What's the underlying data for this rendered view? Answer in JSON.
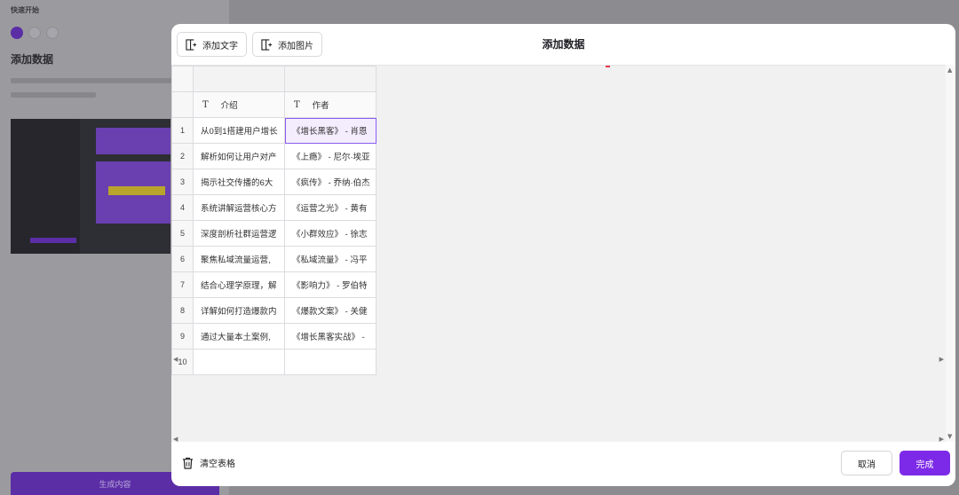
{
  "background": {
    "step_tag": "快速开始",
    "heading": "添加数据",
    "action_label": "生成内容"
  },
  "modal": {
    "title": "添加数据",
    "add_text_label": "添加文字",
    "add_image_label": "添加图片",
    "clear_label": "清空表格",
    "cancel_label": "取消",
    "done_label": "完成"
  },
  "table": {
    "columns": [
      {
        "type_icon": "T",
        "label": "介绍"
      },
      {
        "type_icon": "T",
        "label": "作者"
      }
    ],
    "rows": [
      {
        "num": "1",
        "c1": "从0到1搭建用户增长",
        "c2": "《增长黑客》 - 肖恩"
      },
      {
        "num": "2",
        "c1": "解析如何让用户对产",
        "c2": "《上瘾》 - 尼尔·埃亚"
      },
      {
        "num": "3",
        "c1": "揭示社交传播的6大",
        "c2": "《疯传》 - 乔纳·伯杰"
      },
      {
        "num": "4",
        "c1": "系统讲解运营核心方",
        "c2": "《运营之光》 - 黄有"
      },
      {
        "num": "5",
        "c1": "深度剖析社群运营逻",
        "c2": "《小群效应》 - 徐志"
      },
      {
        "num": "6",
        "c1": "聚焦私域流量运营,",
        "c2": "《私域流量》 - 冯平"
      },
      {
        "num": "7",
        "c1": "结合心理学原理，解",
        "c2": "《影响力》 - 罗伯特"
      },
      {
        "num": "8",
        "c1": "详解如何打造爆款内",
        "c2": "《爆款文案》 - 关健"
      },
      {
        "num": "9",
        "c1": "通过大量本土案例,",
        "c2": "《增长黑客实战》 -"
      },
      {
        "num": "10",
        "c1": "",
        "c2": ""
      }
    ]
  },
  "colors": {
    "accent": "#7d2ae8",
    "selection": "#8a5cf0"
  }
}
